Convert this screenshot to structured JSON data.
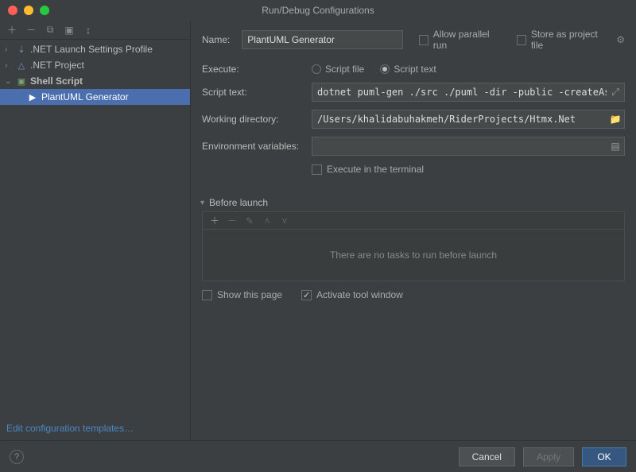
{
  "window": {
    "title": "Run/Debug Configurations"
  },
  "tree": {
    "items": [
      {
        "label": ".NET Launch Settings Profile",
        "arrow": "›"
      },
      {
        "label": ".NET Project",
        "arrow": "›"
      },
      {
        "label": "Shell Script",
        "arrow": "⌄"
      },
      {
        "label": "PlantUML Generator"
      }
    ]
  },
  "sidebar": {
    "editTemplates": "Edit configuration templates…"
  },
  "form": {
    "nameLabel": "Name:",
    "nameValue": "PlantUML Generator",
    "allowParallel": "Allow parallel run",
    "storeAsProject": "Store as project file",
    "executeLabel": "Execute:",
    "scriptFile": "Script file",
    "scriptText": "Script text",
    "scriptTextLabel": "Script text:",
    "scriptTextValue": "dotnet puml-gen ./src ./puml -dir -public -createAssociation",
    "workingDirLabel": "Working directory:",
    "workingDirValue": "/Users/khalidabuhakmeh/RiderProjects/Htmx.Net",
    "envLabel": "Environment variables:",
    "envValue": "",
    "executeTerminal": "Execute in the terminal"
  },
  "beforeLaunch": {
    "title": "Before launch",
    "empty": "There are no tasks to run before launch",
    "showThisPage": "Show this page",
    "activateTool": "Activate tool window"
  },
  "footer": {
    "cancel": "Cancel",
    "apply": "Apply",
    "ok": "OK"
  }
}
